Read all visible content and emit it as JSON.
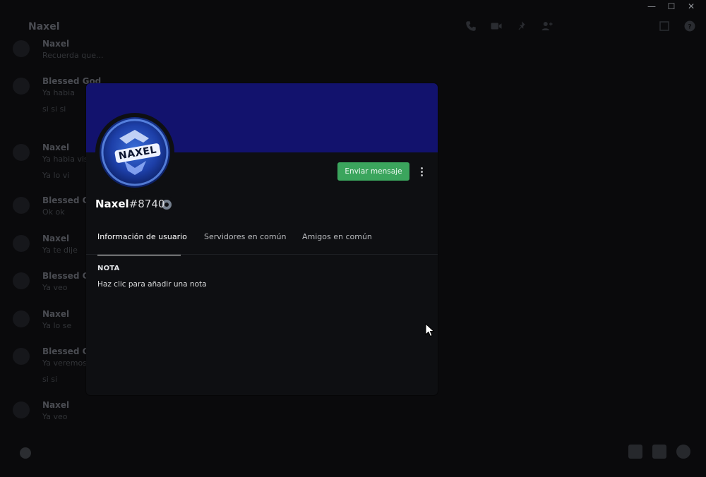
{
  "window": {
    "minimize": "—",
    "maximize": "☐",
    "close": "✕"
  },
  "channel": {
    "title": "Naxel"
  },
  "header_icons": [
    "phone-icon",
    "video-icon",
    "pin-icon",
    "add-friend-icon",
    "inbox-icon",
    "help-icon"
  ],
  "messages": [
    {
      "author": "Naxel",
      "lines": [
        "Recuerda que..."
      ]
    },
    {
      "author": "Blessed God",
      "lines": [
        "Ya habia",
        "si si si"
      ]
    },
    {
      "author": "Naxel",
      "lines": [
        "Ya habia visto",
        "Ya lo vi"
      ]
    },
    {
      "author": "Blessed God",
      "lines": [
        "Ok ok"
      ]
    },
    {
      "author": "Naxel",
      "lines": [
        "Ya te dije"
      ]
    },
    {
      "author": "Blessed God",
      "lines": [
        "Ya veo"
      ]
    },
    {
      "author": "Naxel",
      "lines": [
        "Ya lo se"
      ]
    },
    {
      "author": "Blessed God",
      "lines": [
        "Ya veremos",
        "si si"
      ]
    },
    {
      "author": "Naxel",
      "lines": [
        "Ya veo"
      ]
    }
  ],
  "profile": {
    "banner_color": "#12126d",
    "avatar_text": "NAXEL",
    "username": "Naxel",
    "discriminator": "#8740",
    "send_message_label": "Enviar mensaje",
    "status": "offline",
    "tabs": [
      {
        "label": "Información de usuario",
        "active": true
      },
      {
        "label": "Servidores en común",
        "active": false
      },
      {
        "label": "Amigos en común",
        "active": false
      }
    ],
    "note_title": "NOTA",
    "note_placeholder": "Haz clic para añadir una nota"
  },
  "colors": {
    "accent_green": "#3ba55d",
    "modal_bg": "#0e0f12"
  }
}
